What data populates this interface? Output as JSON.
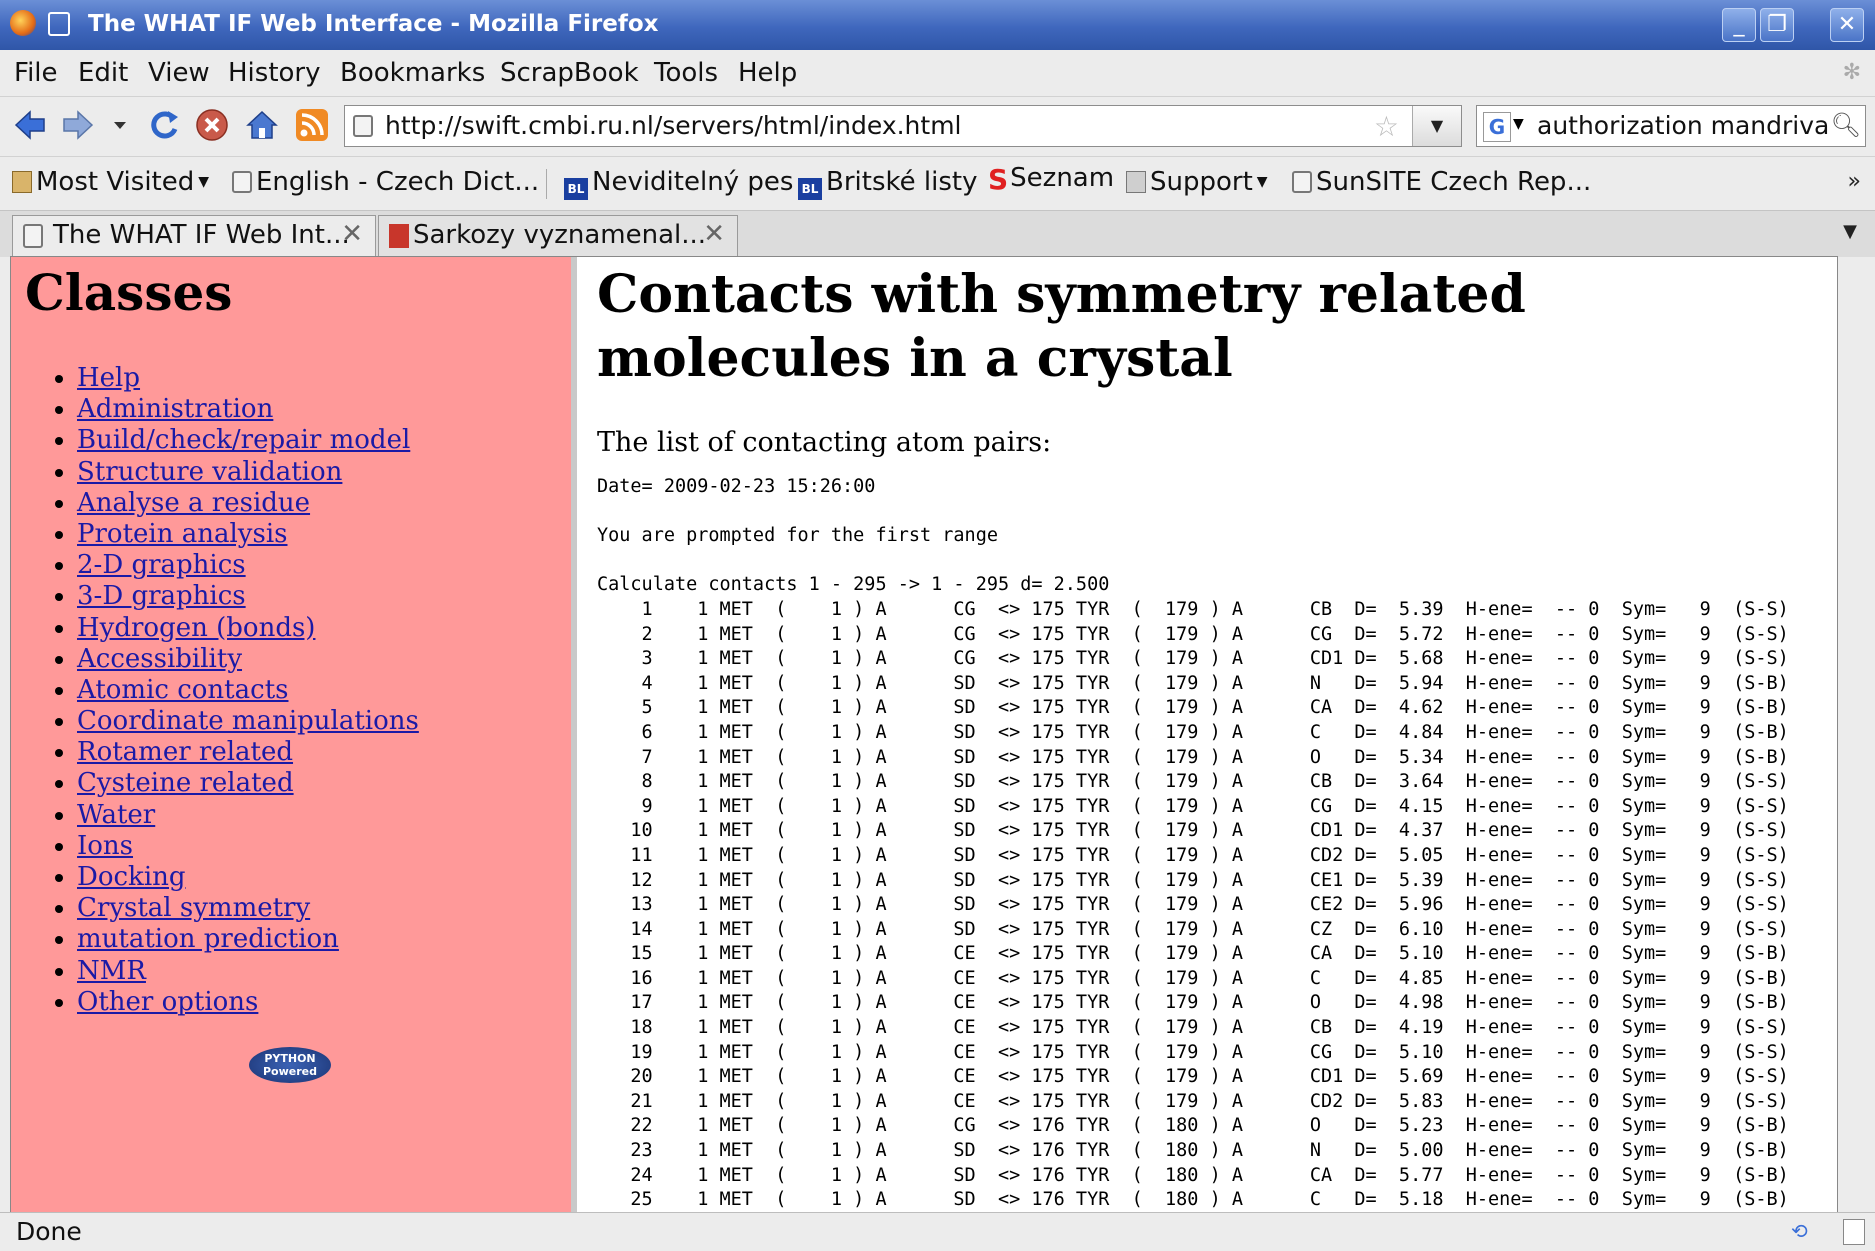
{
  "window": {
    "title": "The WHAT IF Web Interface - Mozilla Firefox",
    "buttons": [
      "_",
      "❐",
      "✕"
    ]
  },
  "menu": [
    {
      "label": "File"
    },
    {
      "label": "Edit"
    },
    {
      "label": "View"
    },
    {
      "label": "History"
    },
    {
      "label": "Bookmarks"
    },
    {
      "label": "ScrapBook"
    },
    {
      "label": "Tools"
    },
    {
      "label": "Help"
    }
  ],
  "navbar": {
    "icons": [
      "back-icon",
      "forward-icon",
      "history-dropdown-icon",
      "reload-icon",
      "stop-icon",
      "home-icon",
      "rss-feed-icon"
    ],
    "url": "http://swift.cmbi.ru.nl/servers/html/index.html",
    "search_engine": "G",
    "search_value": "authorization mandriva"
  },
  "bookmarks": [
    {
      "label": "Most Visited",
      "icon": "folder-icon",
      "dropdown": true
    },
    {
      "label": "English - Czech Dict...",
      "icon": "page-icon"
    },
    {
      "label": "Neviditelný pes",
      "icon": "bl-icon"
    },
    {
      "label": "Britské listy",
      "icon": "bl-icon"
    },
    {
      "label": "Seznam",
      "icon": "seznam-icon"
    },
    {
      "label": "Support",
      "icon": "folder-icon",
      "dropdown": true
    },
    {
      "label": "SunSITE Czech Rep...",
      "icon": "page-icon"
    }
  ],
  "bookmarks_more": "»",
  "tabs": [
    {
      "label": "The WHAT IF Web Int...",
      "active": true
    },
    {
      "label": "Sarkozy vyznamenal...",
      "active": false
    }
  ],
  "tab_close": "✕",
  "left": {
    "heading": "Classes",
    "links": [
      "Help",
      "Administration",
      "Build/check/repair model",
      "Structure validation",
      "Analyse a residue",
      "Protein analysis",
      "2-D graphics",
      "3-D graphics",
      "Hydrogen (bonds)",
      "Accessibility",
      "Atomic contacts",
      "Coordinate manipulations",
      "Rotamer related",
      "Cysteine related",
      "Water",
      "Ions",
      "Docking",
      "Crystal symmetry",
      "mutation prediction",
      "NMR",
      "Other options"
    ],
    "badge": "PYTHON Powered"
  },
  "right": {
    "heading": "Contacts with symmetry related molecules in a crystal",
    "intro": "The list of contacting atom pairs:",
    "date_line": "Date= 2009-02-23 15:26:00",
    "prompt_line": "You are prompted for the first range",
    "calc_line": "Calculate contacts 1 - 295 -> 1 - 295 d= 2.500",
    "rows": [
      {
        "n": "1",
        "res1": "1 MET",
        "seq1": "1",
        "ch1": "A",
        "at1": "CG",
        "res2": "175 TYR",
        "seq2": "179",
        "ch2": "A",
        "at2": "CB",
        "d": "5.39",
        "hene": "-- 0",
        "sym": "9",
        "type": "(S-S)"
      },
      {
        "n": "2",
        "res1": "1 MET",
        "seq1": "1",
        "ch1": "A",
        "at1": "CG",
        "res2": "175 TYR",
        "seq2": "179",
        "ch2": "A",
        "at2": "CG",
        "d": "5.72",
        "hene": "-- 0",
        "sym": "9",
        "type": "(S-S)"
      },
      {
        "n": "3",
        "res1": "1 MET",
        "seq1": "1",
        "ch1": "A",
        "at1": "CG",
        "res2": "175 TYR",
        "seq2": "179",
        "ch2": "A",
        "at2": "CD1",
        "d": "5.68",
        "hene": "-- 0",
        "sym": "9",
        "type": "(S-S)"
      },
      {
        "n": "4",
        "res1": "1 MET",
        "seq1": "1",
        "ch1": "A",
        "at1": "SD",
        "res2": "175 TYR",
        "seq2": "179",
        "ch2": "A",
        "at2": "N",
        "d": "5.94",
        "hene": "-- 0",
        "sym": "9",
        "type": "(S-B)"
      },
      {
        "n": "5",
        "res1": "1 MET",
        "seq1": "1",
        "ch1": "A",
        "at1": "SD",
        "res2": "175 TYR",
        "seq2": "179",
        "ch2": "A",
        "at2": "CA",
        "d": "4.62",
        "hene": "-- 0",
        "sym": "9",
        "type": "(S-B)"
      },
      {
        "n": "6",
        "res1": "1 MET",
        "seq1": "1",
        "ch1": "A",
        "at1": "SD",
        "res2": "175 TYR",
        "seq2": "179",
        "ch2": "A",
        "at2": "C",
        "d": "4.84",
        "hene": "-- 0",
        "sym": "9",
        "type": "(S-B)"
      },
      {
        "n": "7",
        "res1": "1 MET",
        "seq1": "1",
        "ch1": "A",
        "at1": "SD",
        "res2": "175 TYR",
        "seq2": "179",
        "ch2": "A",
        "at2": "O",
        "d": "5.34",
        "hene": "-- 0",
        "sym": "9",
        "type": "(S-B)"
      },
      {
        "n": "8",
        "res1": "1 MET",
        "seq1": "1",
        "ch1": "A",
        "at1": "SD",
        "res2": "175 TYR",
        "seq2": "179",
        "ch2": "A",
        "at2": "CB",
        "d": "3.64",
        "hene": "-- 0",
        "sym": "9",
        "type": "(S-S)"
      },
      {
        "n": "9",
        "res1": "1 MET",
        "seq1": "1",
        "ch1": "A",
        "at1": "SD",
        "res2": "175 TYR",
        "seq2": "179",
        "ch2": "A",
        "at2": "CG",
        "d": "4.15",
        "hene": "-- 0",
        "sym": "9",
        "type": "(S-S)"
      },
      {
        "n": "10",
        "res1": "1 MET",
        "seq1": "1",
        "ch1": "A",
        "at1": "SD",
        "res2": "175 TYR",
        "seq2": "179",
        "ch2": "A",
        "at2": "CD1",
        "d": "4.37",
        "hene": "-- 0",
        "sym": "9",
        "type": "(S-S)"
      },
      {
        "n": "11",
        "res1": "1 MET",
        "seq1": "1",
        "ch1": "A",
        "at1": "SD",
        "res2": "175 TYR",
        "seq2": "179",
        "ch2": "A",
        "at2": "CD2",
        "d": "5.05",
        "hene": "-- 0",
        "sym": "9",
        "type": "(S-S)"
      },
      {
        "n": "12",
        "res1": "1 MET",
        "seq1": "1",
        "ch1": "A",
        "at1": "SD",
        "res2": "175 TYR",
        "seq2": "179",
        "ch2": "A",
        "at2": "CE1",
        "d": "5.39",
        "hene": "-- 0",
        "sym": "9",
        "type": "(S-S)"
      },
      {
        "n": "13",
        "res1": "1 MET",
        "seq1": "1",
        "ch1": "A",
        "at1": "SD",
        "res2": "175 TYR",
        "seq2": "179",
        "ch2": "A",
        "at2": "CE2",
        "d": "5.96",
        "hene": "-- 0",
        "sym": "9",
        "type": "(S-S)"
      },
      {
        "n": "14",
        "res1": "1 MET",
        "seq1": "1",
        "ch1": "A",
        "at1": "SD",
        "res2": "175 TYR",
        "seq2": "179",
        "ch2": "A",
        "at2": "CZ",
        "d": "6.10",
        "hene": "-- 0",
        "sym": "9",
        "type": "(S-S)"
      },
      {
        "n": "15",
        "res1": "1 MET",
        "seq1": "1",
        "ch1": "A",
        "at1": "CE",
        "res2": "175 TYR",
        "seq2": "179",
        "ch2": "A",
        "at2": "CA",
        "d": "5.10",
        "hene": "-- 0",
        "sym": "9",
        "type": "(S-B)"
      },
      {
        "n": "16",
        "res1": "1 MET",
        "seq1": "1",
        "ch1": "A",
        "at1": "CE",
        "res2": "175 TYR",
        "seq2": "179",
        "ch2": "A",
        "at2": "C",
        "d": "4.85",
        "hene": "-- 0",
        "sym": "9",
        "type": "(S-B)"
      },
      {
        "n": "17",
        "res1": "1 MET",
        "seq1": "1",
        "ch1": "A",
        "at1": "CE",
        "res2": "175 TYR",
        "seq2": "179",
        "ch2": "A",
        "at2": "O",
        "d": "4.98",
        "hene": "-- 0",
        "sym": "9",
        "type": "(S-B)"
      },
      {
        "n": "18",
        "res1": "1 MET",
        "seq1": "1",
        "ch1": "A",
        "at1": "CE",
        "res2": "175 TYR",
        "seq2": "179",
        "ch2": "A",
        "at2": "CB",
        "d": "4.19",
        "hene": "-- 0",
        "sym": "9",
        "type": "(S-S)"
      },
      {
        "n": "19",
        "res1": "1 MET",
        "seq1": "1",
        "ch1": "A",
        "at1": "CE",
        "res2": "175 TYR",
        "seq2": "179",
        "ch2": "A",
        "at2": "CG",
        "d": "5.10",
        "hene": "-- 0",
        "sym": "9",
        "type": "(S-S)"
      },
      {
        "n": "20",
        "res1": "1 MET",
        "seq1": "1",
        "ch1": "A",
        "at1": "CE",
        "res2": "175 TYR",
        "seq2": "179",
        "ch2": "A",
        "at2": "CD1",
        "d": "5.69",
        "hene": "-- 0",
        "sym": "9",
        "type": "(S-S)"
      },
      {
        "n": "21",
        "res1": "1 MET",
        "seq1": "1",
        "ch1": "A",
        "at1": "CE",
        "res2": "175 TYR",
        "seq2": "179",
        "ch2": "A",
        "at2": "CD2",
        "d": "5.83",
        "hene": "-- 0",
        "sym": "9",
        "type": "(S-S)"
      },
      {
        "n": "22",
        "res1": "1 MET",
        "seq1": "1",
        "ch1": "A",
        "at1": "CG",
        "res2": "176 TYR",
        "seq2": "180",
        "ch2": "A",
        "at2": "O",
        "d": "5.23",
        "hene": "-- 0",
        "sym": "9",
        "type": "(S-B)"
      },
      {
        "n": "23",
        "res1": "1 MET",
        "seq1": "1",
        "ch1": "A",
        "at1": "SD",
        "res2": "176 TYR",
        "seq2": "180",
        "ch2": "A",
        "at2": "N",
        "d": "5.00",
        "hene": "-- 0",
        "sym": "9",
        "type": "(S-B)"
      },
      {
        "n": "24",
        "res1": "1 MET",
        "seq1": "1",
        "ch1": "A",
        "at1": "SD",
        "res2": "176 TYR",
        "seq2": "180",
        "ch2": "A",
        "at2": "CA",
        "d": "5.77",
        "hene": "-- 0",
        "sym": "9",
        "type": "(S-B)"
      },
      {
        "n": "25",
        "res1": "1 MET",
        "seq1": "1",
        "ch1": "A",
        "at1": "SD",
        "res2": "176 TYR",
        "seq2": "180",
        "ch2": "A",
        "at2": "C",
        "d": "5.18",
        "hene": "-- 0",
        "sym": "9",
        "type": "(S-B)"
      }
    ]
  },
  "status": {
    "text": "Done"
  },
  "colors": {
    "left_frame_bg": "#ff9999",
    "link": "#1a1aa6",
    "titlebar": "#3f67bd"
  }
}
